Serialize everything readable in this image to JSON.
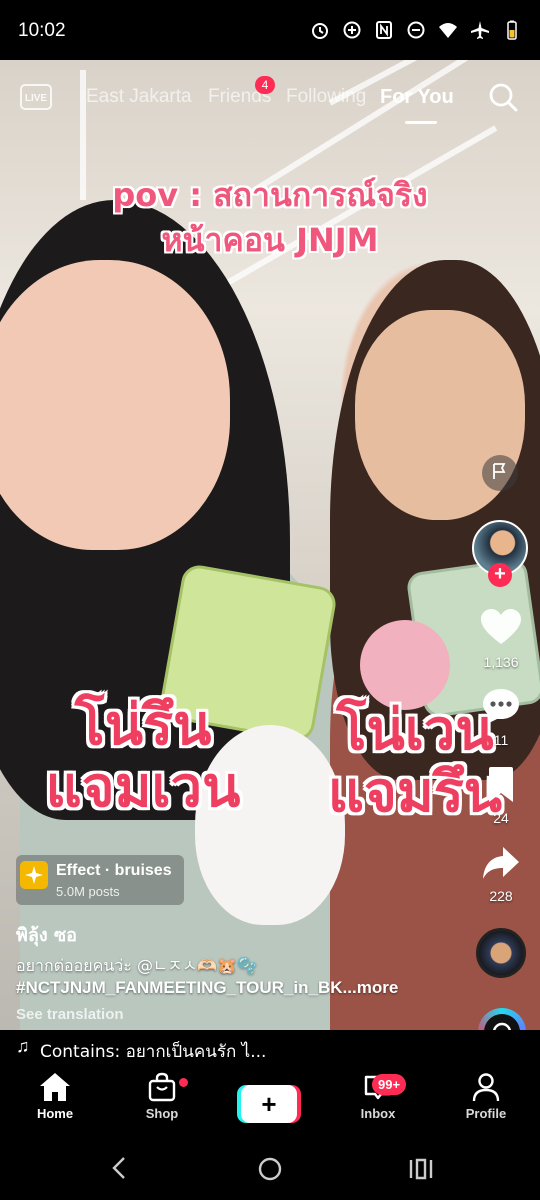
{
  "status_bar": {
    "time": "10:02",
    "icons": [
      "alarm-icon",
      "data-saver-icon",
      "nfc-icon",
      "do-not-disturb-icon",
      "wifi-icon",
      "airplane-icon",
      "battery-icon"
    ]
  },
  "top_nav": {
    "live_label": "LIVE",
    "tabs": [
      {
        "label": "East Jakarta"
      },
      {
        "label": "Friends",
        "badge": "4"
      },
      {
        "label": "Following"
      },
      {
        "label": "For You",
        "active": true
      }
    ]
  },
  "video": {
    "caption_line1": "pov : สถานการณ์จริง",
    "caption_line2": "หน้าคอน JNJM",
    "left_caption_line1": "โน่รึน",
    "left_caption_line2": "แจมเวน",
    "right_caption_line1": "โน่เวน",
    "right_caption_line2": "แจมรึน"
  },
  "side_actions": {
    "likes": "1,136",
    "comments": "11",
    "bookmarks": "24",
    "shares": "228"
  },
  "effect": {
    "name": "Effect · bruises",
    "posts": "5.0M posts"
  },
  "post": {
    "username": "พิลุ้ง ซอ",
    "description_line1": "อยากต่ออยคนว่ะ @ㄴㅈㅅ🫶🏻🐹🫧",
    "description_line2": "#NCTJNJM_FANMEETING_TOUR_in_BK...",
    "more": "more",
    "see_translation": "See translation"
  },
  "music": {
    "text": "Contains: อยากเป็นคนรัก ไ..."
  },
  "bottom_nav": {
    "home": "Home",
    "shop": "Shop",
    "inbox": "Inbox",
    "inbox_badge": "99+",
    "profile": "Profile"
  },
  "colors": {
    "accent": "#fe2c55",
    "cyan": "#25f4ee",
    "caption_pink": "#ef3f61"
  }
}
